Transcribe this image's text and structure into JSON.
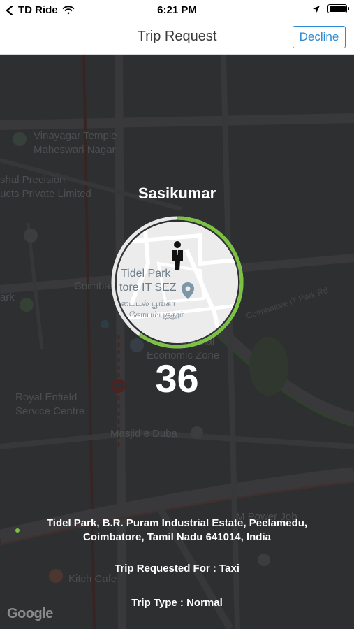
{
  "status_bar": {
    "carrier": "TD Ride",
    "time": "6:21 PM"
  },
  "nav": {
    "title": "Trip Request",
    "decline_label": "Decline"
  },
  "map": {
    "labels": {
      "vinayagar": "Vinayagar Temple",
      "maheswari": "Maheswari Nagar",
      "precision1": "shal Precision",
      "precision2": "ucts Private Limited",
      "coimbatore": "Coimbatore",
      "park": "ark",
      "road": "Coimbatore IT Park Rd",
      "royal1": "Royal Enfield",
      "royal2": "Service Centre",
      "masjid": "Masjid e Duba",
      "special1": "Special",
      "special2": "Economic Zone",
      "kitch": "Kitch Cafe",
      "power": "M Power Job"
    },
    "google": "Google"
  },
  "mini_map": {
    "line1": "Tidel Park",
    "line2": "tore IT SEZ",
    "tamil1": "டைடல் பூங்கா",
    "tamil2": "கோயம்புத்தூர்"
  },
  "request": {
    "rider_name": "Sasikumar",
    "countdown": "36",
    "countdown_progress": 0.6,
    "address_line1": "Tidel Park, B.R. Puram Industrial Estate, Peelamedu,",
    "address_line2": "Coimbatore, Tamil Nadu 641014, India",
    "trip_requested_for": "Trip Requested For : Taxi",
    "trip_type": "Trip Type : Normal"
  },
  "colors": {
    "accent": "#2d8ad3",
    "ring_progress": "#7cc242",
    "ring_track": "#e8e8e8"
  }
}
